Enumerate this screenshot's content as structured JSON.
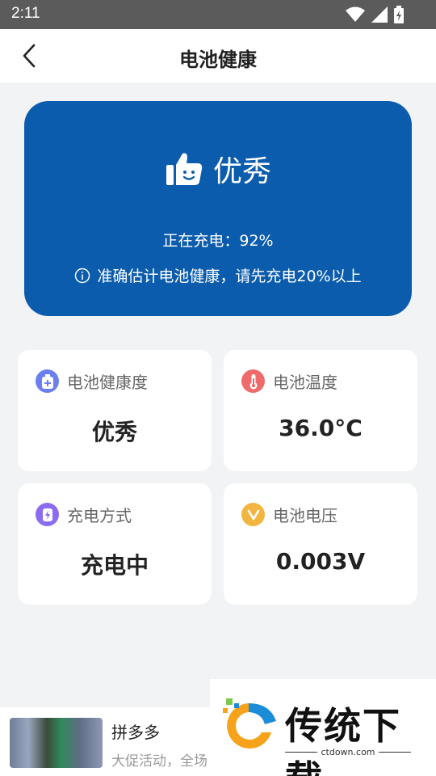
{
  "status_bar": {
    "time": "2:11"
  },
  "header": {
    "title": "电池健康"
  },
  "hero": {
    "rating": "优秀",
    "charging_text": "正在充电：92%",
    "note": "准确估计电池健康，请先充电20%以上"
  },
  "cards": [
    {
      "label": "电池健康度",
      "value": "优秀",
      "icon": "battery-health-icon",
      "color": "#6b7ff0"
    },
    {
      "label": "电池温度",
      "value": "36.0°C",
      "icon": "thermometer-icon",
      "color": "#ef6b6b"
    },
    {
      "label": "充电方式",
      "value": "充电中",
      "icon": "charging-icon",
      "color": "#8b6bf0"
    },
    {
      "label": "电池电压",
      "value": "0.003V",
      "icon": "voltage-icon",
      "color": "#f2b640"
    }
  ],
  "ad": {
    "title": "拼多多",
    "description": "大促活动，全场"
  },
  "watermark": {
    "text": "传统下载",
    "url": "ctdown.com"
  },
  "colors": {
    "hero_bg": "#0b5cad",
    "page_bg": "#f2f3f5",
    "status_bar": "#5b5b5b"
  }
}
